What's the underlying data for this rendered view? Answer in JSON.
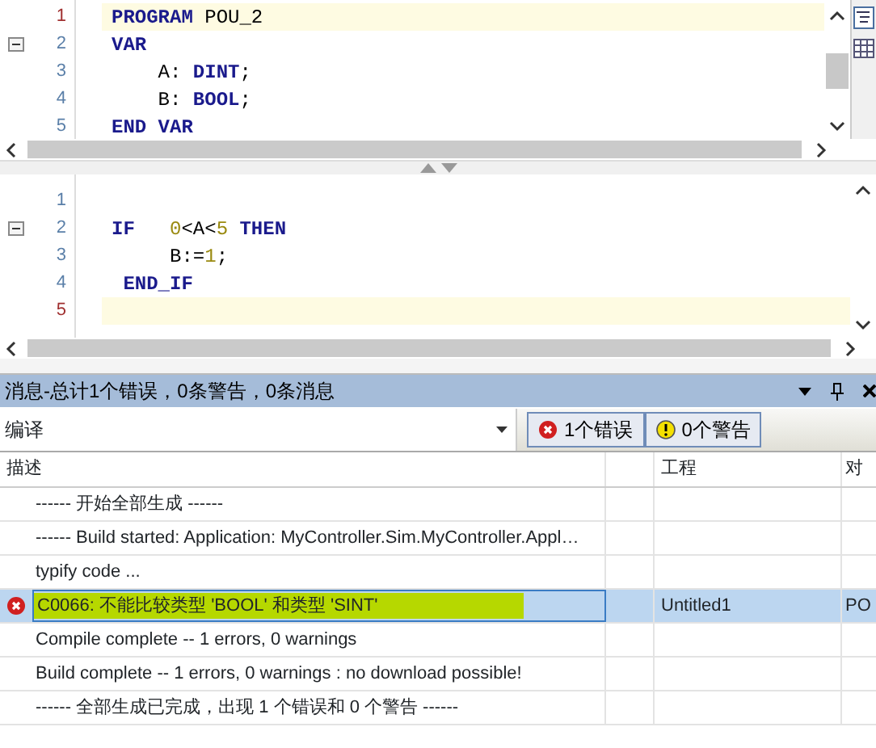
{
  "editors": [
    {
      "lines": [
        {
          "number": "1",
          "current": true,
          "foldable": false,
          "tokens": [
            {
              "kind": "keyword",
              "text": "PROGRAM"
            },
            {
              "kind": "text",
              "text": " POU_2"
            }
          ]
        },
        {
          "number": "2",
          "current": false,
          "foldable": true,
          "tokens": [
            {
              "kind": "keyword",
              "text": "VAR"
            }
          ]
        },
        {
          "number": "3",
          "current": false,
          "foldable": false,
          "tokens": [
            {
              "kind": "text",
              "text": "    A: "
            },
            {
              "kind": "keyword",
              "text": "DINT"
            },
            {
              "kind": "text",
              "text": ";"
            }
          ]
        },
        {
          "number": "4",
          "current": false,
          "foldable": false,
          "tokens": [
            {
              "kind": "text",
              "text": "    B: "
            },
            {
              "kind": "keyword",
              "text": "BOOL"
            },
            {
              "kind": "text",
              "text": ";"
            }
          ]
        },
        {
          "number": "5",
          "current": false,
          "foldable": false,
          "tokens": [
            {
              "kind": "keyword",
              "text": "END VAR"
            }
          ]
        }
      ]
    },
    {
      "lines": [
        {
          "number": "1",
          "current": false,
          "foldable": false
        },
        {
          "number": "2",
          "current": false,
          "foldable": true,
          "tokens": [
            {
              "kind": "keyword",
              "text": "IF   "
            },
            {
              "kind": "number",
              "text": "0"
            },
            {
              "kind": "text",
              "text": "<A<"
            },
            {
              "kind": "number",
              "text": "5 "
            },
            {
              "kind": "keyword",
              "text": "THEN"
            }
          ]
        },
        {
          "number": "3",
          "current": false,
          "foldable": false,
          "tokens": [
            {
              "kind": "text",
              "text": "     B:="
            },
            {
              "kind": "number",
              "text": "1"
            },
            {
              "kind": "text",
              "text": ";"
            }
          ]
        },
        {
          "number": "4",
          "current": false,
          "foldable": false,
          "tokens": [
            {
              "kind": "keyword",
              "text": " END_IF"
            }
          ]
        },
        {
          "number": "5",
          "current": true,
          "foldable": false
        }
      ]
    }
  ],
  "messages_panel": {
    "title": "消息-总计1个错误，0条警告，0条消息",
    "category": {
      "value": "编译"
    },
    "filters": [
      {
        "kind": "error",
        "label": "1个错误",
        "selected": true
      },
      {
        "kind": "warning",
        "label": "0个警告",
        "selected": true
      }
    ],
    "columns": [
      "描述",
      "工程",
      "对"
    ],
    "rows": [
      {
        "kind": "info",
        "description": "------ 开始全部生成 ------",
        "selected": false,
        "highlighted": false
      },
      {
        "kind": "info",
        "description": "------ Build started: Application: MyController.Sim.MyController.Appl…",
        "selected": false,
        "highlighted": false
      },
      {
        "kind": "info",
        "description": "typify code ...",
        "selected": false,
        "highlighted": false
      },
      {
        "kind": "error",
        "description": "C0066: 不能比较类型 'BOOL' 和类型 'SINT'",
        "project": "Untitled1",
        "object": "PO",
        "selected": true,
        "highlighted": true
      },
      {
        "kind": "info",
        "description": "Compile complete -- 1 errors, 0 warnings",
        "selected": false,
        "highlighted": false
      },
      {
        "kind": "info",
        "description": "Build complete -- 1 errors, 0 warnings : no download possible!",
        "selected": false,
        "highlighted": false
      },
      {
        "kind": "info",
        "description": "------ 全部生成已完成，出现 1 个错误和 0 个警告 ------",
        "selected": false,
        "highlighted": false
      }
    ]
  }
}
